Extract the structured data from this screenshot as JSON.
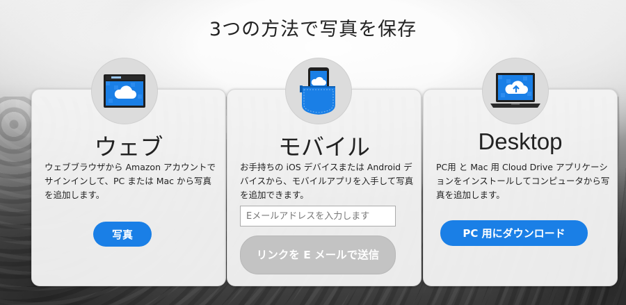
{
  "headline": "3つの方法で写真を保存",
  "cards": {
    "web": {
      "title": "ウェブ",
      "icon": "browser-cloud-icon",
      "description": "ウェブブラウザから Amazon アカウントでサインインして、PC または Mac から写真を追加します。",
      "button": "写真"
    },
    "mobile": {
      "title": "モバイル",
      "icon": "phone-pocket-icon",
      "description": "お手持ちの iOS デバイスまたは Android デバイスから、モバイルアプリを入手して写真を追加できます。",
      "email_placeholder": "Eメールアドレスを入力します",
      "send_button": "リンクを E メールで送信"
    },
    "desktop": {
      "title": "Desktop",
      "icon": "laptop-upload-icon",
      "description": "PC用 と Mac 用 Cloud Drive アプリケーションをインストールしてコンピュータから写真を追加します。",
      "button": "PC 用にダウンロード"
    }
  },
  "colors": {
    "accent": "#1a7fe6",
    "disabled_button": "#c3c3c3"
  }
}
